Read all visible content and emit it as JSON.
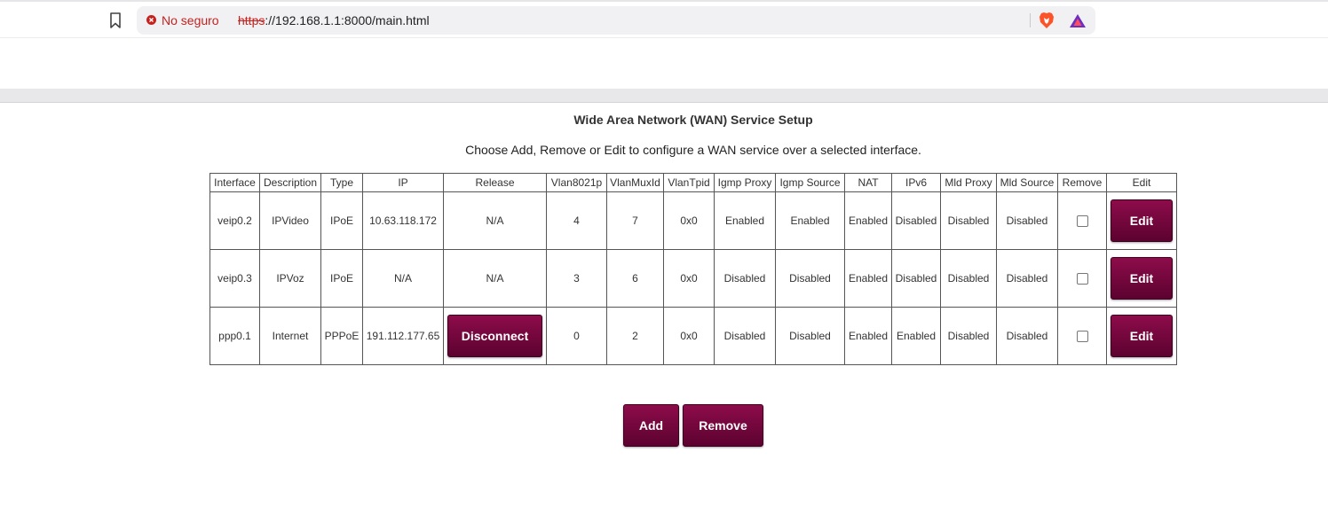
{
  "browser": {
    "security_label": "No seguro",
    "url_scheme": "https",
    "url_rest": "://192.168.1.1:8000/main.html"
  },
  "page": {
    "title": "Wide Area Network (WAN) Service Setup",
    "subtitle": "Choose Add, Remove or Edit to configure a WAN service over a selected interface."
  },
  "table": {
    "headers": [
      "Interface",
      "Description",
      "Type",
      "IP",
      "Release",
      "Vlan8021p",
      "VlanMuxId",
      "VlanTpid",
      "Igmp Proxy",
      "Igmp Source",
      "NAT",
      "IPv6",
      "Mld Proxy",
      "Mld Source",
      "Remove",
      "Edit"
    ],
    "rows": [
      {
        "interface": "veip0.2",
        "description": "IPVideo",
        "type": "IPoE",
        "ip": "10.63.118.172",
        "release": "N/A",
        "vlan8021p": "4",
        "vlanmuxid": "7",
        "vlantpid": "0x0",
        "igmp_proxy": "Enabled",
        "igmp_source": "Enabled",
        "nat": "Enabled",
        "ipv6": "Disabled",
        "mld_proxy": "Disabled",
        "mld_source": "Disabled",
        "edit_label": "Edit"
      },
      {
        "interface": "veip0.3",
        "description": "IPVoz",
        "type": "IPoE",
        "ip": "N/A",
        "release": "N/A",
        "vlan8021p": "3",
        "vlanmuxid": "6",
        "vlantpid": "0x0",
        "igmp_proxy": "Disabled",
        "igmp_source": "Disabled",
        "nat": "Enabled",
        "ipv6": "Disabled",
        "mld_proxy": "Disabled",
        "mld_source": "Disabled",
        "edit_label": "Edit"
      },
      {
        "interface": "ppp0.1",
        "description": "Internet",
        "type": "PPPoE",
        "ip": "191.112.177.65",
        "release_button": "Disconnect",
        "vlan8021p": "0",
        "vlanmuxid": "2",
        "vlantpid": "0x0",
        "igmp_proxy": "Disabled",
        "igmp_source": "Disabled",
        "nat": "Enabled",
        "ipv6": "Enabled",
        "mld_proxy": "Disabled",
        "mld_source": "Disabled",
        "edit_label": "Edit"
      }
    ]
  },
  "actions": {
    "add_label": "Add",
    "remove_label": "Remove"
  },
  "colors": {
    "button_maroon": "#7a0840",
    "insecure_red": "#c5221f"
  }
}
